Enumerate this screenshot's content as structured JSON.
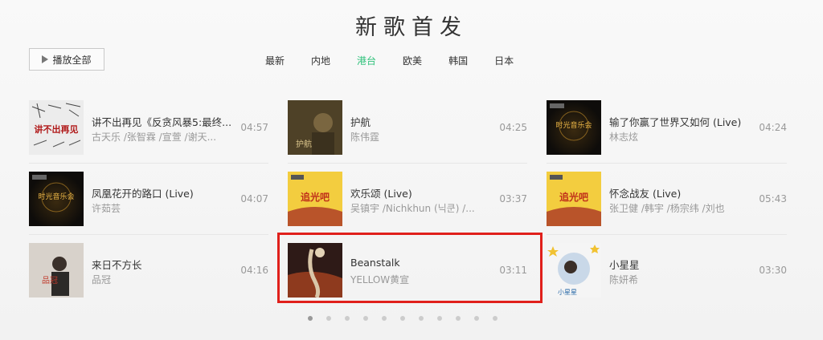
{
  "title": "新歌首发",
  "play_all": "播放全部",
  "tabs": [
    "最新",
    "内地",
    "港台",
    "欧美",
    "韩国",
    "日本"
  ],
  "active_tab": "港台",
  "columns": [
    [
      {
        "name": "讲不出再见《反贪风暴5:最终...",
        "artist": "古天乐 /张智霖 /宣萱 /谢天...",
        "duration": "04:57",
        "cover_text": "讲不出再见"
      },
      {
        "name": "凤凰花开的路口 (Live)",
        "artist": "许茹芸",
        "duration": "04:07",
        "cover_text": "时光音乐会"
      },
      {
        "name": "来日不方长",
        "artist": "品冠",
        "duration": "04:16",
        "cover_text": "品冠"
      }
    ],
    [
      {
        "name": "护航",
        "artist": "陈伟霆",
        "duration": "04:25",
        "cover_text": "护航"
      },
      {
        "name": "欢乐颂 (Live)",
        "artist": "吴镇宇 /Nichkhun (닉쿤) /...",
        "duration": "03:37",
        "cover_text": "追光吧"
      },
      {
        "name": "Beanstalk",
        "artist": "YELLOW黄宣",
        "duration": "03:11",
        "cover_text": ""
      }
    ],
    [
      {
        "name": "输了你赢了世界又如何 (Live)",
        "artist": "林志炫",
        "duration": "04:24",
        "cover_text": "时光音乐会"
      },
      {
        "name": "怀念战友 (Live)",
        "artist": "张卫健 /韩宇 /杨宗纬 /刘也",
        "duration": "05:43",
        "cover_text": "追光吧"
      },
      {
        "name": "小星星",
        "artist": "陈妍希",
        "duration": "03:30",
        "cover_text": "小星星"
      }
    ]
  ],
  "pagination": {
    "count": 11,
    "active": 0
  },
  "colors": {
    "accent": "#31c27c",
    "highlight": "#e0201b"
  }
}
